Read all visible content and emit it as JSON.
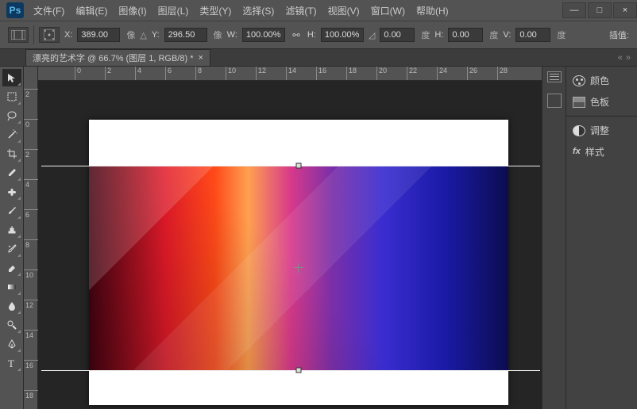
{
  "titlebar": {
    "logo": "Ps"
  },
  "menu": [
    "文件(F)",
    "编辑(E)",
    "图像(I)",
    "图层(L)",
    "类型(Y)",
    "选择(S)",
    "滤镜(T)",
    "视图(V)",
    "窗口(W)",
    "帮助(H)"
  ],
  "win": {
    "min": "—",
    "max": "□",
    "close": "×"
  },
  "options": {
    "x_label": "X:",
    "x_val": "389.00",
    "x_unit": "像",
    "y_label": "Y:",
    "y_val": "296.50",
    "y_unit": "像",
    "w_label": "W:",
    "w_val": "100.00%",
    "h_label": "H:",
    "h_val": "100.00%",
    "angle_val": "0.00",
    "angle_unit": "度",
    "skew_h_label": "H:",
    "skew_h_val": "0.00",
    "skew_h_unit": "度",
    "skew_v_label": "V:",
    "skew_v_val": "0.00",
    "skew_v_unit": "度",
    "interp": "插值:"
  },
  "doctab": {
    "title": "漂亮的艺术字 @ 66.7% (图层 1, RGB/8) *"
  },
  "ruler_h": [
    "0",
    "2",
    "4",
    "6",
    "8",
    "10",
    "12",
    "14",
    "16",
    "18",
    "20",
    "22",
    "24",
    "26",
    "28"
  ],
  "ruler_v": [
    "2",
    "0",
    "2",
    "4",
    "6",
    "8",
    "10",
    "12",
    "14",
    "16",
    "18"
  ],
  "panels": {
    "color": "颜色",
    "swatches": "色板",
    "adjust": "调整",
    "styles": "样式"
  }
}
